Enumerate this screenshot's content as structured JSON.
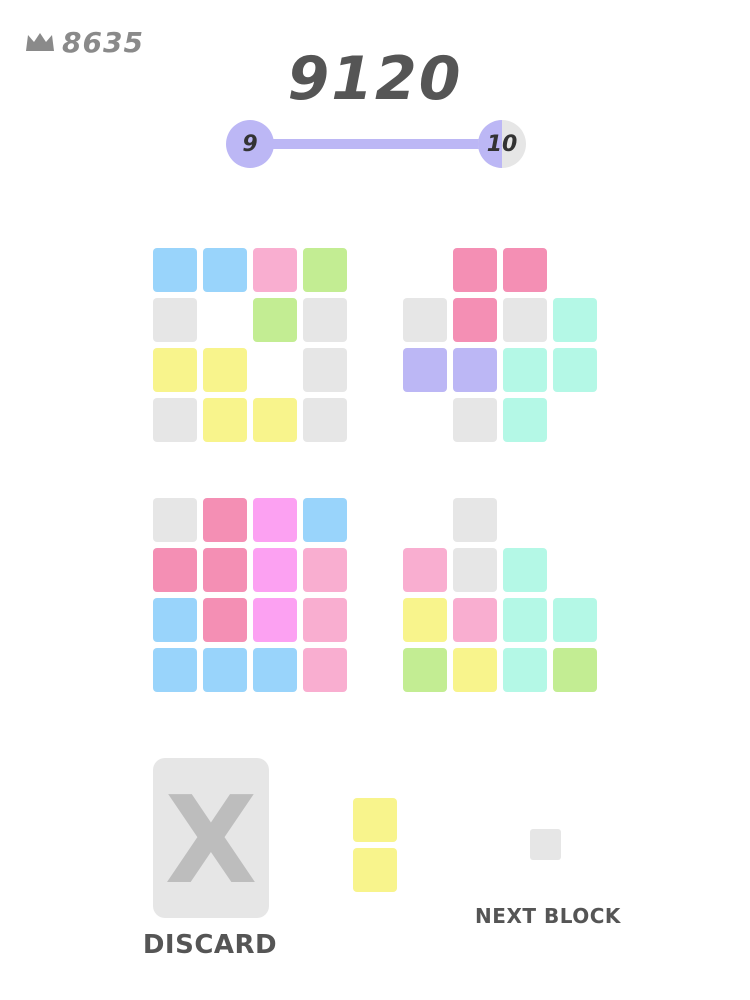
{
  "header": {
    "best_score": "8635",
    "best_icon": "crown-icon",
    "score": "9120"
  },
  "level": {
    "current": "9",
    "next": "10",
    "progress": 1.0,
    "colors": {
      "fill": "#bcb7f5",
      "empty": "#e6e6e6"
    }
  },
  "colors": {
    "e": "#e6e6e6",
    "b": "#99d4fb",
    "p": "#f9aed0",
    "g": "#c3ed93",
    "y": "#f8f48c",
    "m": "#f48fb4",
    "t": "#b4f8e6",
    "v": "#bcb7f5",
    "f": "#fca1f2"
  },
  "boards": [
    {
      "name": "top-left",
      "rows": [
        "bbpg",
        "e.ge",
        "yy.e",
        "eyye"
      ]
    },
    {
      "name": "top-right",
      "rows": [
        ".mm.",
        "emet",
        "vvtt",
        ".et."
      ]
    },
    {
      "name": "bottom-left",
      "rows": [
        "emfb",
        "mmfp",
        "bmfp",
        "bbbp"
      ]
    },
    {
      "name": "bottom-right",
      "rows": [
        ".e..",
        "pet.",
        "yptt",
        "gytg"
      ]
    }
  ],
  "discard": {
    "label": "DISCARD",
    "symbol": "X",
    "icon": "x-icon",
    "colors": {
      "bg": "#e6e6e6",
      "symbol": "#bdbdbd"
    }
  },
  "current_piece": {
    "color": "y",
    "cells": 2,
    "orientation": "vertical"
  },
  "next_block": {
    "label": "NEXT BLOCK",
    "color": "e",
    "cells": 1
  }
}
